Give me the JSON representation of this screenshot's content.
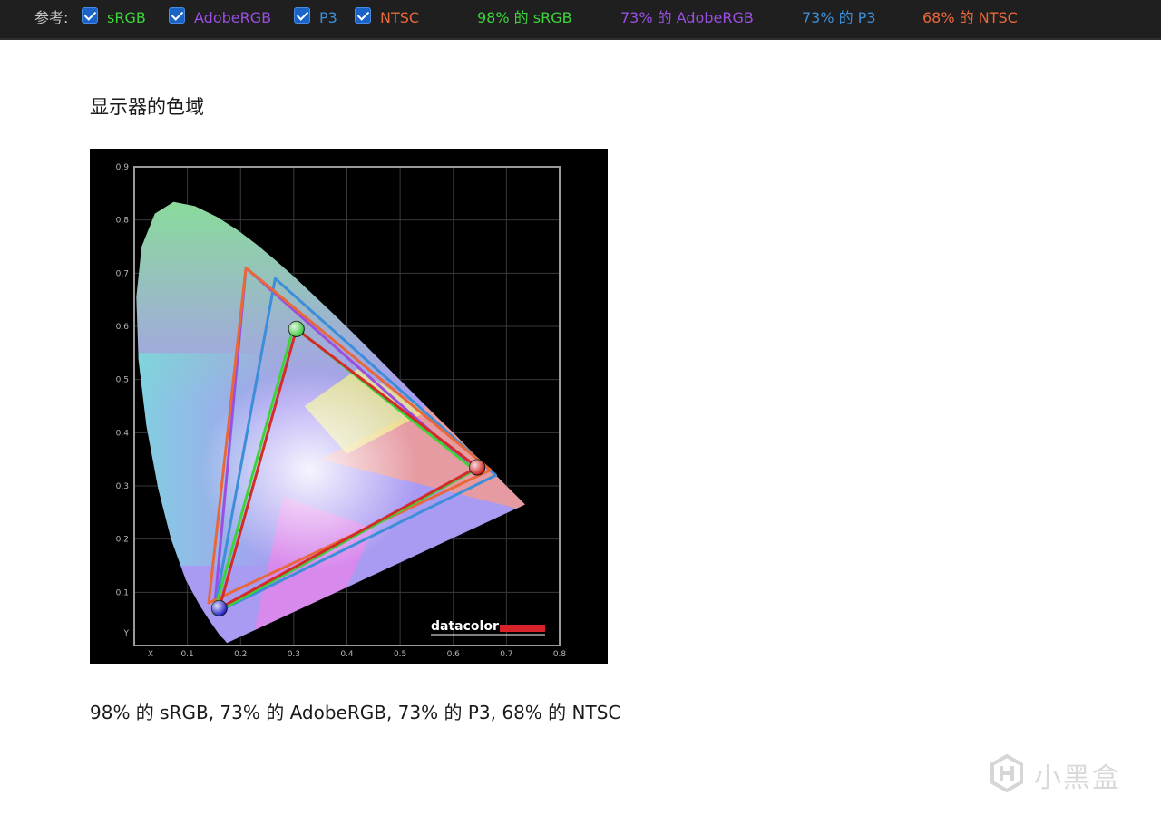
{
  "toolbar": {
    "label": "参考:",
    "checkboxes": [
      {
        "label": "sRGB",
        "color": "#3bd43b",
        "checked": true
      },
      {
        "label": "AdobeRGB",
        "color": "#9a4fe0",
        "checked": true
      },
      {
        "label": "P3",
        "color": "#3d8ed8",
        "checked": true
      },
      {
        "label": "NTSC",
        "color": "#e8683a",
        "checked": true
      }
    ],
    "stats": [
      {
        "text": "98% 的 sRGB",
        "color": "#3bd43b"
      },
      {
        "text": "73% 的 AdobeRGB",
        "color": "#9a4fe0"
      },
      {
        "text": "73% 的 P3",
        "color": "#3d8ed8"
      },
      {
        "text": "68% 的 NTSC",
        "color": "#e8683a"
      }
    ]
  },
  "section": {
    "title": "显示器的色域",
    "caption": "98% 的 sRGB, 73% 的 AdobeRGB, 73% 的 P3, 68% 的 NTSC"
  },
  "chart_data": {
    "type": "scatter",
    "xlim": [
      0,
      0.8
    ],
    "ylim": [
      0,
      0.9
    ],
    "x_ticks": [
      "X",
      "0.1",
      "0.2",
      "0.3",
      "0.4",
      "0.5",
      "0.6",
      "0.7",
      "0.8"
    ],
    "y_ticks": [
      "Y",
      "0.1",
      "0.2",
      "0.3",
      "0.4",
      "0.5",
      "0.6",
      "0.7",
      "0.8",
      "0.9"
    ],
    "grid": true,
    "logo": "datacolor",
    "spectral_locus": [
      [
        0.175,
        0.005
      ],
      [
        0.174,
        0.005
      ],
      [
        0.17,
        0.01
      ],
      [
        0.161,
        0.019
      ],
      [
        0.142,
        0.046
      ],
      [
        0.124,
        0.074
      ],
      [
        0.097,
        0.123
      ],
      [
        0.069,
        0.201
      ],
      [
        0.045,
        0.295
      ],
      [
        0.023,
        0.413
      ],
      [
        0.008,
        0.538
      ],
      [
        0.004,
        0.655
      ],
      [
        0.014,
        0.75
      ],
      [
        0.039,
        0.812
      ],
      [
        0.074,
        0.834
      ],
      [
        0.114,
        0.826
      ],
      [
        0.155,
        0.806
      ],
      [
        0.193,
        0.782
      ],
      [
        0.23,
        0.754
      ],
      [
        0.266,
        0.724
      ],
      [
        0.302,
        0.692
      ],
      [
        0.337,
        0.659
      ],
      [
        0.373,
        0.625
      ],
      [
        0.409,
        0.59
      ],
      [
        0.445,
        0.554
      ],
      [
        0.482,
        0.517
      ],
      [
        0.516,
        0.483
      ],
      [
        0.547,
        0.452
      ],
      [
        0.575,
        0.424
      ],
      [
        0.602,
        0.398
      ],
      [
        0.627,
        0.372
      ],
      [
        0.648,
        0.351
      ],
      [
        0.666,
        0.334
      ],
      [
        0.68,
        0.32
      ],
      [
        0.691,
        0.309
      ],
      [
        0.701,
        0.299
      ],
      [
        0.709,
        0.291
      ],
      [
        0.735,
        0.265
      ]
    ],
    "gamuts": [
      {
        "name": "AdobeRGB",
        "color": "#9a4fe0",
        "points": [
          [
            0.64,
            0.33
          ],
          [
            0.21,
            0.71
          ],
          [
            0.15,
            0.06
          ]
        ]
      },
      {
        "name": "P3",
        "color": "#3d8ed8",
        "points": [
          [
            0.68,
            0.32
          ],
          [
            0.265,
            0.69
          ],
          [
            0.15,
            0.06
          ]
        ]
      },
      {
        "name": "NTSC",
        "color": "#e8683a",
        "points": [
          [
            0.67,
            0.33
          ],
          [
            0.21,
            0.71
          ],
          [
            0.14,
            0.08
          ]
        ]
      },
      {
        "name": "sRGB",
        "color": "#3bd43b",
        "points": [
          [
            0.64,
            0.33
          ],
          [
            0.3,
            0.6
          ],
          [
            0.15,
            0.06
          ]
        ]
      },
      {
        "name": "display",
        "color": "#d42a2a",
        "points": [
          [
            0.645,
            0.335
          ],
          [
            0.305,
            0.595
          ],
          [
            0.16,
            0.07
          ]
        ]
      }
    ],
    "primaries": [
      {
        "label": "R",
        "color": "#d02020",
        "point": [
          0.645,
          0.335
        ]
      },
      {
        "label": "G",
        "color": "#3ec83e",
        "point": [
          0.305,
          0.595
        ]
      },
      {
        "label": "B",
        "color": "#2020c8",
        "point": [
          0.16,
          0.07
        ]
      }
    ]
  }
}
